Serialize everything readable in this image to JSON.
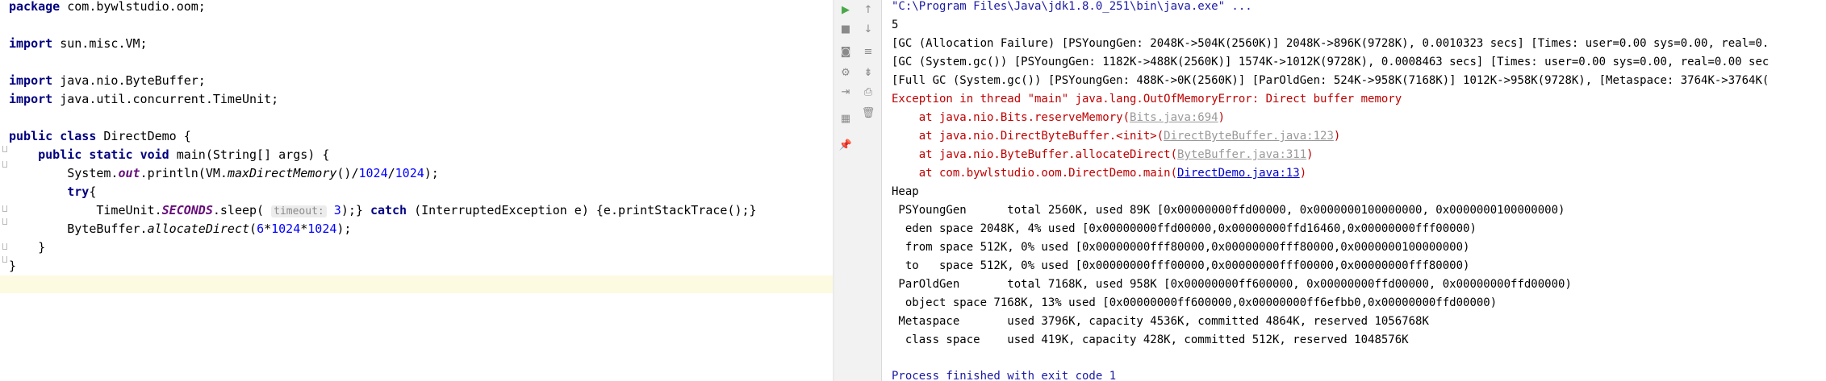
{
  "editor": {
    "lines": [
      {
        "t": "package com.bywlstudio.oom;"
      },
      {
        "t": ""
      },
      {
        "t": "import sun.misc.VM;"
      },
      {
        "t": ""
      },
      {
        "t": "import java.nio.ByteBuffer;"
      },
      {
        "t": "import java.util.concurrent.TimeUnit;"
      },
      {
        "t": ""
      },
      {
        "t": "public class DirectDemo {"
      },
      {
        "t": "    public static void main(String[] args) {"
      },
      {
        "t": "        System.out.println(VM.maxDirectMemory()/1024/1024);"
      },
      {
        "t": "        try{"
      },
      {
        "t": "            TimeUnit.SECONDS.sleep( timeout: 3);} catch (InterruptedException e) {e.printStackTrace();}"
      },
      {
        "t": "        ByteBuffer.allocateDirect(6*1024*1024);"
      },
      {
        "t": "    }"
      },
      {
        "t": "}"
      }
    ],
    "tokens": {
      "package_kw": "package",
      "package_name": " com.bywlstudio.oom;",
      "import_kw": "import",
      "imp1": " sun.misc.VM;",
      "imp2": " java.nio.ByteBuffer;",
      "imp3": " java.util.concurrent.TimeUnit;",
      "public_kw": "public",
      "class_kw": "class",
      "class_name": " DirectDemo {",
      "static_kw": "static",
      "void_kw": "void",
      "main_sig": " main(String[] args) {",
      "sysout_a": "System.",
      "sysout_out": "out",
      "sysout_b": ".println(VM.",
      "maxdm": "maxDirectMemory",
      "sysout_c": "()/",
      "n1024a": "1024",
      "slash": "/",
      "n1024b": "1024",
      "sysout_d": ");",
      "try_kw": "try",
      "brace_open": "{",
      "tu_a": "TimeUnit.",
      "seconds": "SECONDS",
      "tu_b": ".sleep(",
      "hint": "timeout:",
      "n3": "3",
      "tu_c": ");} ",
      "catch_kw": "catch",
      "tu_d": " (InterruptedException e) {e.printStackTrace();}",
      "bb_a": "ByteBuffer.",
      "alloc": "allocateDirect",
      "bb_b": "(",
      "n6": "6",
      "star1": "*",
      "n1024c": "1024",
      "star2": "*",
      "n1024d": "1024",
      "bb_c": ");",
      "close1": "    }",
      "close2": "}"
    }
  },
  "console": {
    "cmd": "\"C:\\Program Files\\Java\\jdk1.8.0_251\\bin\\java.exe\" ...",
    "out5": "5",
    "gc1": "[GC (Allocation Failure) [PSYoungGen: 2048K->504K(2560K)] 2048K->896K(9728K), 0.0010323 secs] [Times: user=0.00 sys=0.00, real=0.",
    "gc2": "[GC (System.gc()) [PSYoungGen: 1182K->488K(2560K)] 1574K->1012K(9728K), 0.0008463 secs] [Times: user=0.00 sys=0.00, real=0.00 sec",
    "gc3": "[Full GC (System.gc()) [PSYoungGen: 488K->0K(2560K)] [ParOldGen: 524K->958K(7168K)] 1012K->958K(9728K), [Metaspace: 3764K->3764K(",
    "err": "Exception in thread \"main\" java.lang.OutOfMemoryError: Direct buffer memory",
    "tr1_a": "    at java.nio.Bits.reserveMemory(",
    "tr1_link": "Bits.java:694",
    "tr1_b": ")",
    "tr2_a": "    at java.nio.DirectByteBuffer.<init>(",
    "tr2_link": "DirectByteBuffer.java:123",
    "tr2_b": ")",
    "tr3_a": "    at java.nio.ByteBuffer.allocateDirect(",
    "tr3_link": "ByteBuffer.java:311",
    "tr3_b": ")",
    "tr4_a": "    at com.bywlstudio.oom.DirectDemo.main(",
    "tr4_link": "DirectDemo.java:13",
    "tr4_b": ")",
    "heap": "Heap",
    "h1": " PSYoungGen      total 2560K, used 89K [0x00000000ffd00000, 0x0000000100000000, 0x0000000100000000)",
    "h2": "  eden space 2048K, 4% used [0x00000000ffd00000,0x00000000ffd16460,0x00000000fff00000)",
    "h3": "  from space 512K, 0% used [0x00000000fff80000,0x00000000fff80000,0x0000000100000000)",
    "h4": "  to   space 512K, 0% used [0x00000000fff00000,0x00000000fff00000,0x00000000fff80000)",
    "h5": " ParOldGen       total 7168K, used 958K [0x00000000ff600000, 0x00000000ffd00000, 0x00000000ffd00000)",
    "h6": "  object space 7168K, 13% used [0x00000000ff600000,0x00000000ff6efbb0,0x00000000ffd00000)",
    "h7": " Metaspace       used 3796K, capacity 4536K, committed 4864K, reserved 1056768K",
    "h8": "  class space    used 419K, capacity 428K, committed 512K, reserved 1048576K",
    "finish": "Process finished with exit code 1"
  },
  "toolbar": {
    "icons": [
      "rerun-icon",
      "arrow-up-icon",
      "stop-icon",
      "arrow-down-icon",
      "camera-icon",
      "soft-wrap-icon",
      "settings-icon",
      "scroll-to-end-icon",
      "exit-icon",
      "print-icon",
      "layout-icon",
      "trash-icon",
      "pin-icon"
    ]
  },
  "colors": {
    "keyword": "#000080",
    "number": "#0000ff",
    "field": "#660e7a",
    "error": "#c00000",
    "link": "#0000cc",
    "caret_line": "#fcfae0"
  }
}
